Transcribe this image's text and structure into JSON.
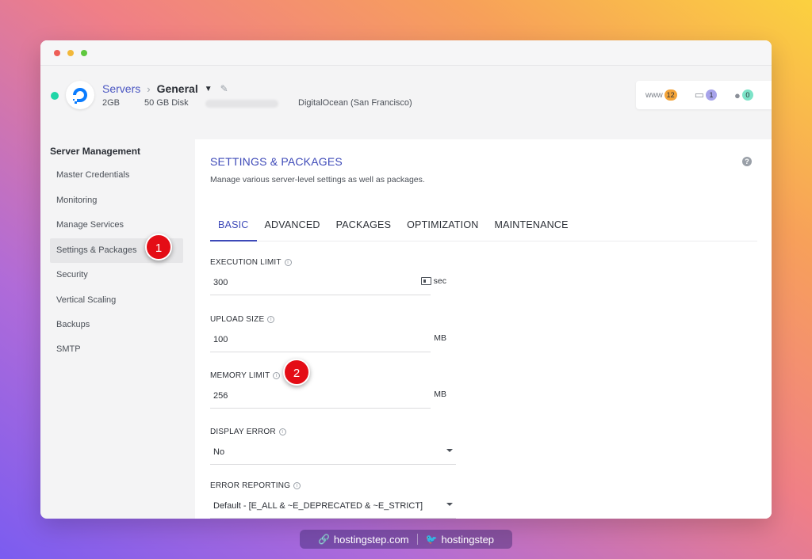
{
  "header": {
    "breadcrumb": {
      "servers": "Servers",
      "current": "General"
    },
    "server": {
      "ram": "2GB",
      "disk": "50 GB Disk",
      "location": "DigitalOcean (San Francisco)"
    },
    "stats": {
      "www_label": "www",
      "www_count": "12",
      "files_count": "1",
      "users_count": "0"
    }
  },
  "sidebar": {
    "title": "Server Management",
    "items": [
      {
        "label": "Master Credentials"
      },
      {
        "label": "Monitoring"
      },
      {
        "label": "Manage Services"
      },
      {
        "label": "Settings & Packages"
      },
      {
        "label": "Security"
      },
      {
        "label": "Vertical Scaling"
      },
      {
        "label": "Backups"
      },
      {
        "label": "SMTP"
      }
    ]
  },
  "markers": {
    "one": "1",
    "two": "2"
  },
  "panel": {
    "title": "SETTINGS & PACKAGES",
    "subtitle": "Manage various server-level settings as well as packages.",
    "help": "?",
    "tabs": [
      "BASIC",
      "ADVANCED",
      "PACKAGES",
      "OPTIMIZATION",
      "MAINTENANCE"
    ],
    "fields": {
      "execution": {
        "label": "EXECUTION LIMIT",
        "value": "300",
        "unit": "sec"
      },
      "upload": {
        "label": "UPLOAD SIZE",
        "value": "100",
        "unit": "MB"
      },
      "memory": {
        "label": "MEMORY LIMIT",
        "value": "256",
        "unit": "MB"
      },
      "display_error": {
        "label": "DISPLAY ERROR",
        "value": "No"
      },
      "error_reporting": {
        "label": "ERROR REPORTING",
        "value": "Default - [E_ALL & ~E_DEPRECATED & ~E_STRICT]"
      }
    }
  },
  "footer": {
    "site": "hostingstep.com",
    "twitter": "hostingstep"
  }
}
